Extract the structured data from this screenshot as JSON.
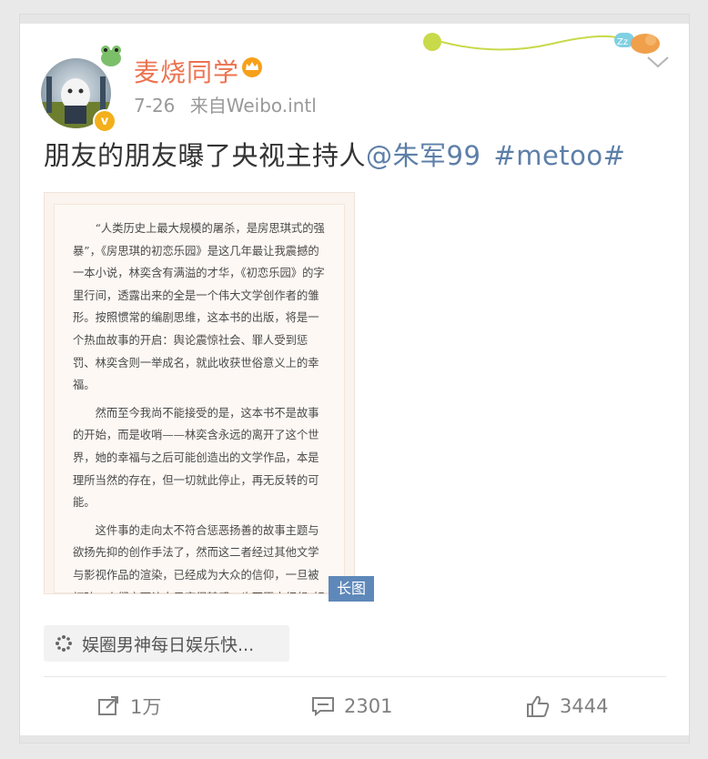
{
  "post": {
    "username": "麦烧同学",
    "date": "7-26",
    "source": "来自Weibo.intl",
    "content_text": "朋友的朋友曝了央视主持人",
    "mention": "@朱军99",
    "hashtag": "#metoo#",
    "image_badge": "长图",
    "source_chip": "娱圈男神每日娱乐快..."
  },
  "image_text": [
    "“人类历史上最大规模的屠杀，是房思琪式的强暴”，《房思琪的初恋乐园》是这几年最让我震撼的一本小说，林奕含有满溢的才华，《初恋乐园》的字里行间，透露出来的全是一个伟大文学创作者的雏形。按照惯常的编剧思维，这本书的出版，将是一个热血故事的开启：舆论震惊社会、罪人受到惩罚、林奕含则一举成名，就此收获世俗意义上的幸福。",
    "然而至今我尚不能接受的是，这本书不是故事的开始，而是收哨——林奕含永远的离开了这个世界，她的幸福与之后可能创造出的文学作品，本是理所当然的存在，但一切就此停止，再无反转的可能。",
    "这件事的走向太不符合惩恶扬善的故事主题与欲扬先抑的创作手法了，然而这二者经过其他文学与影视作品的渲染，已经成为大众的信仰，一旦被打破，人们宁可让自己变得转感，也不愿去细想“好人没好报”这背后的真相。"
  ],
  "actions": {
    "repost": "1万",
    "comment": "2301",
    "like": "3444"
  },
  "colors": {
    "username": "#eb7350",
    "link": "#5d7fa8",
    "badge": "#5e88b9",
    "vip": "#f3b01c"
  },
  "icons": [
    "frog-sticker-icon",
    "verified-badge-icon",
    "crown-icon",
    "chevron-down-icon",
    "gear-icon",
    "repost-icon",
    "comment-icon",
    "like-icon",
    "sleeping-cat-icon"
  ]
}
